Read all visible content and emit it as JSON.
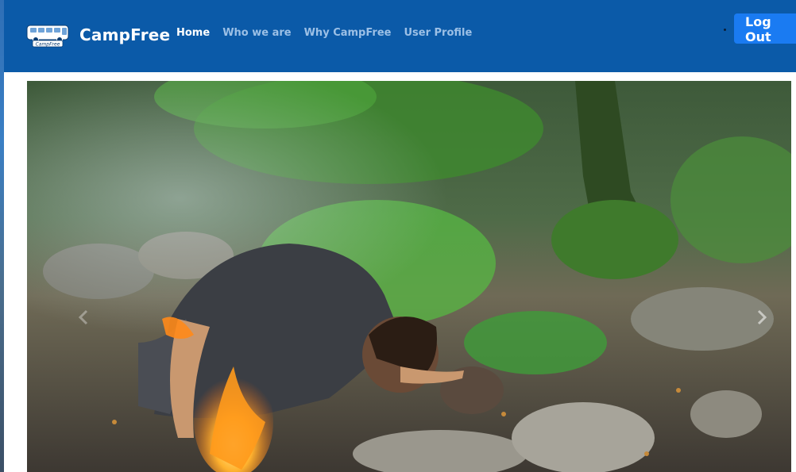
{
  "brand": {
    "logo_text": "CampFree",
    "name": "CampFree"
  },
  "nav": {
    "items": [
      {
        "label": "Home",
        "active": true
      },
      {
        "label": "Who we are",
        "active": false
      },
      {
        "label": "Why CampFree",
        "active": false
      },
      {
        "label": "User Profile",
        "active": false
      }
    ]
  },
  "header": {
    "logout_label": "Log Out"
  },
  "carousel": {
    "image_alt": "",
    "icons": {
      "prev": "chevron-left-icon",
      "next": "chevron-right-icon"
    }
  },
  "colors": {
    "navbar": "#0b5aa8",
    "nav_active": "#ffffff",
    "nav_inactive": "#9cc0e6",
    "button": "#1a7bf2"
  }
}
